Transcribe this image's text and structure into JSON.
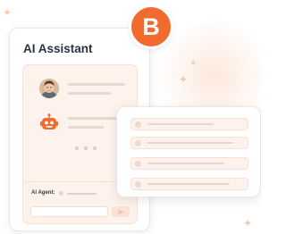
{
  "colors": {
    "accent": "#f26b2e",
    "panel_bg": "#fdf2ec",
    "placeholder_bar": "#e8d8cf",
    "title_text": "#2a3340"
  },
  "brand_badge": {
    "letter": "B"
  },
  "assistant_card": {
    "title": "AI Assistant",
    "messages": [
      {
        "sender": "user",
        "icon": "user-avatar-icon"
      },
      {
        "sender": "bot",
        "icon": "robot-icon"
      }
    ],
    "typing_indicator": {
      "dots": 3
    },
    "agent_panel": {
      "label": "AI Agent:",
      "message_input": {
        "value": ""
      },
      "send_button": {
        "icon": "send-icon"
      }
    }
  },
  "list_card": {
    "rows": 4
  }
}
